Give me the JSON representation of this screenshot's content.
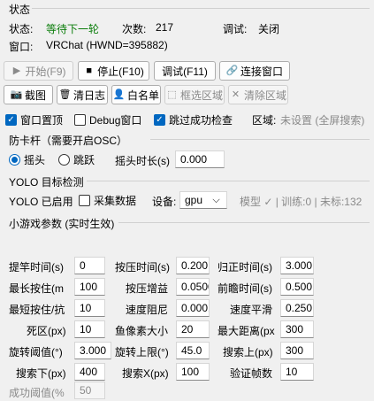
{
  "status": {
    "group_title": "状态",
    "state_label": "状态:",
    "state_value": "等待下一轮",
    "count_label": "次数:",
    "count_value": "217",
    "debug_label": "调试:",
    "debug_value": "关闭",
    "window_label": "窗口:",
    "window_value": "VRChat (HWND=395882)",
    "state_color": "#0a7d0a"
  },
  "toolbar1": {
    "start": "开始(F9)",
    "stop": "停止(F10)",
    "debug": "调试(F11)",
    "connect": "连接窗口"
  },
  "toolbar2": {
    "screenshot": "截图",
    "clear_log": "清日志",
    "whitelist": "白名单",
    "select_region": "框选区域",
    "clear_region": "清除区域"
  },
  "options": {
    "topmost": "窗口置顶",
    "debug_window": "Debug窗口",
    "skip_check": "跳过成功检查",
    "region_label": "区域:",
    "region_value": "未设置 (全屏搜索)"
  },
  "anti_stuck": {
    "group_title": "防卡杆（需要开启OSC）",
    "shake": "摇头",
    "jump": "跳跃",
    "duration_label": "摇头时长(s)",
    "duration_value": "0.000"
  },
  "yolo": {
    "group_title": "YOLO 目标检测",
    "enabled_label": "YOLO 已启用",
    "collect_label": "采集数据",
    "device_label": "设备:",
    "device_value": "gpu",
    "model_status": "模型 ✓ | 训练:0 | 未标:132"
  },
  "params": {
    "group_title": "小游戏参数 (实时生效)",
    "rows": [
      [
        {
          "label": "提竿时间(s)",
          "value": "0"
        },
        {
          "label": "按压时间(s)",
          "value": "0.200"
        },
        {
          "label": "归正时间(s)",
          "value": "3.000"
        }
      ],
      [
        {
          "label": "最长按住(m",
          "value": "100"
        },
        {
          "label": "按压增益",
          "value": "0.0500"
        },
        {
          "label": "前瞻时间(s)",
          "value": "0.500"
        }
      ],
      [
        {
          "label": "最短按住/抗",
          "value": "10"
        },
        {
          "label": "速度阻尼",
          "value": "0.00013"
        },
        {
          "label": "速度平滑",
          "value": "0.250"
        }
      ],
      [
        {
          "label": "死区(px)",
          "value": "10"
        },
        {
          "label": "鱼像素大小",
          "value": "20"
        },
        {
          "label": "最大距离(px",
          "value": "300"
        }
      ],
      [
        {
          "label": "旋转阈值(°)",
          "value": "3.000"
        },
        {
          "label": "旋转上限(°)",
          "value": "45.0"
        },
        {
          "label": "搜索上(px)",
          "value": "300"
        }
      ],
      [
        {
          "label": "搜索下(px)",
          "value": "400"
        },
        {
          "label": "搜索X(px)",
          "value": "100"
        },
        {
          "label": "验证帧数",
          "value": "10"
        }
      ]
    ],
    "success_label": "成功阈值(%",
    "success_value": "50"
  }
}
